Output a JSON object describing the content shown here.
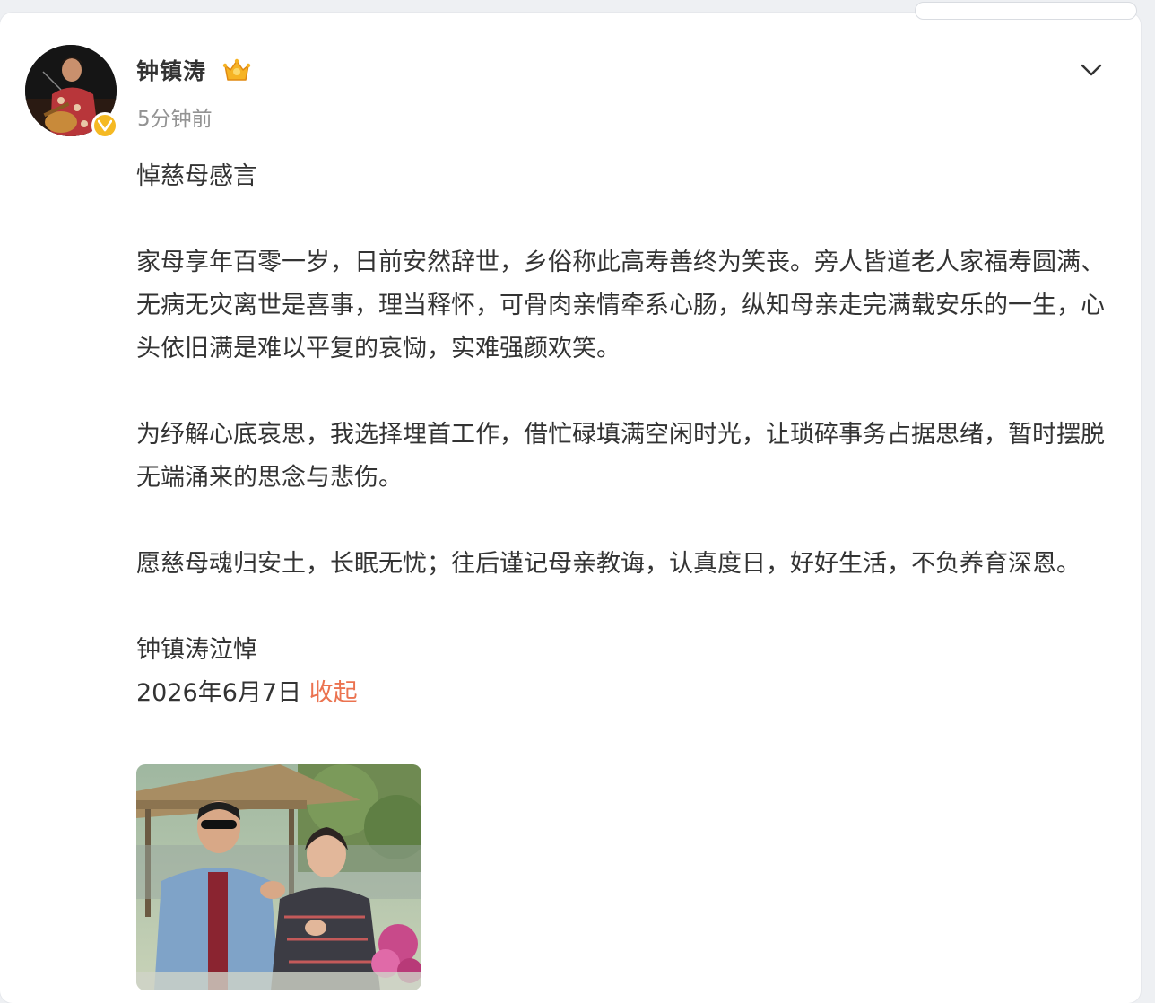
{
  "post": {
    "author": "钟镇涛",
    "time": "5分钟前",
    "title": "悼慈母感言",
    "paragraphs": [
      "家母享年百零一岁，日前安然辞世，乡俗称此高寿善终为笑丧。旁人皆道老人家福寿圆满、无病无灾离世是喜事，理当释怀，可骨肉亲情牵系心肠，纵知母亲走完满载安乐的一生，心头依旧满是难以平复的哀恸，实难强颜欢笑。",
      "为纾解心底哀思，我选择埋首工作，借忙碌填满空闲时光，让琐碎事务占据思绪，暂时摆脱无端涌来的思念与悲伤。",
      "愿慈母魂归安土，长眠无忧；往后谨记母亲教诲，认真度日，好好生活，不负养育深恩。"
    ],
    "signature": "钟镇涛泣悼",
    "date": "2026年6月7日",
    "collapse_label": "收起"
  },
  "icons": {
    "verified": "verified-badge-icon",
    "crown": "crown-icon",
    "menu": "chevron-down-icon"
  },
  "colors": {
    "link": "#eb7350",
    "badge": "#f5b923",
    "meta": "#939393",
    "text": "#333333"
  }
}
